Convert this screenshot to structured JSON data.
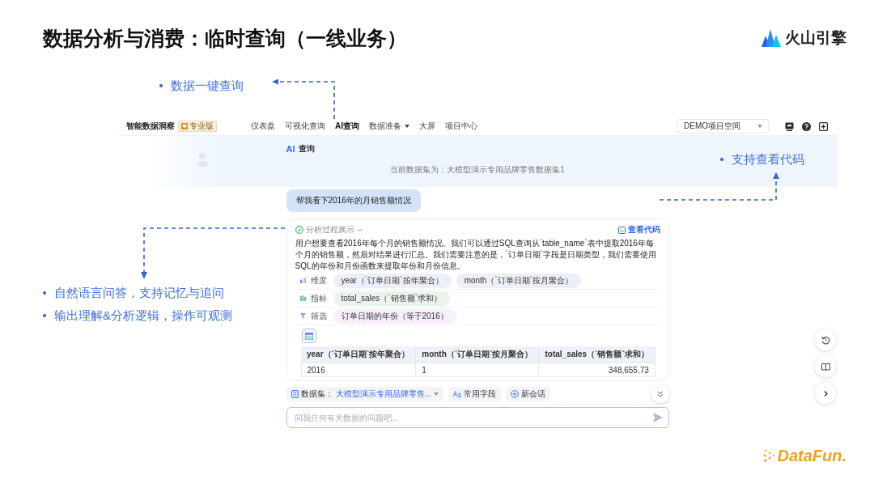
{
  "slide": {
    "title": "数据分析与消费：临时查询（一线业务）",
    "brand_logo": "火山引擎"
  },
  "callouts": [
    {
      "kind": "nav",
      "items": [
        "数据一键查询"
      ]
    },
    {
      "kind": "code",
      "items": [
        "支持查看代码"
      ]
    },
    {
      "kind": "answer",
      "items": [
        "自然语言问答，支持记忆与追问",
        "输出理解&分析逻辑，操作可观测"
      ]
    }
  ],
  "app": {
    "brand": "智能数据洞察",
    "edition_badge": "专业版",
    "nav": [
      {
        "label": "仪表盘",
        "selected": false,
        "dropdown": false
      },
      {
        "label": "可视化查询",
        "selected": false,
        "dropdown": false
      },
      {
        "label": "AI查询",
        "selected": true,
        "dropdown": false
      },
      {
        "label": "数据准备",
        "selected": false,
        "dropdown": true
      },
      {
        "label": "大屏",
        "selected": false,
        "dropdown": false
      },
      {
        "label": "项目中心",
        "selected": false,
        "dropdown": false
      }
    ],
    "project_select": "DEMO项目空间",
    "page_title": {
      "badge": "AI",
      "text": "查询"
    },
    "dataset_notice": "当前数据集为：大模型演示专用品牌零售数据集1",
    "user_message": "帮我看下2016年的月销售额情况",
    "answer": {
      "process_label": "分析过程展示",
      "code_link": "查看代码",
      "explanation": "用户想要查看2016年每个月的销售额情况。我们可以通过SQL查询从`table_name`表中提取2016年每个月的销售额，然后对结果进行汇总。我们需要注意的是，`订单日期`字段是日期类型，我们需要使用SQL的年份和月份函数来提取年份和月份信息。",
      "fields": [
        {
          "kind": "dimension",
          "label": "维度",
          "chips": [
            "year（`订单日期`按年聚合）",
            "month（`订单日期`按月聚合）"
          ]
        },
        {
          "kind": "metric",
          "label": "指标",
          "chips": [
            "total_sales（`销售额`求和）"
          ]
        },
        {
          "kind": "filter",
          "label": "筛选",
          "chips": [
            "订单日期的年份（等于2016）"
          ]
        }
      ],
      "table": {
        "columns": [
          "year（`订单日期`按年聚合）",
          "month（`订单日期`按月聚合）",
          "total_sales（`销售额`求和）"
        ],
        "rows": [
          [
            "2016",
            "1",
            "348,655.73"
          ]
        ]
      }
    },
    "composer": {
      "dataset_label": "数据集：",
      "dataset_value": "大模型演示专用品牌零售...",
      "actions": [
        {
          "kind": "fields",
          "label": "常用字段"
        },
        {
          "kind": "new_chat",
          "label": "新会话"
        }
      ],
      "placeholder": "问我任何有关数据的问题吧..."
    }
  },
  "footer_logo": "DataFun."
}
